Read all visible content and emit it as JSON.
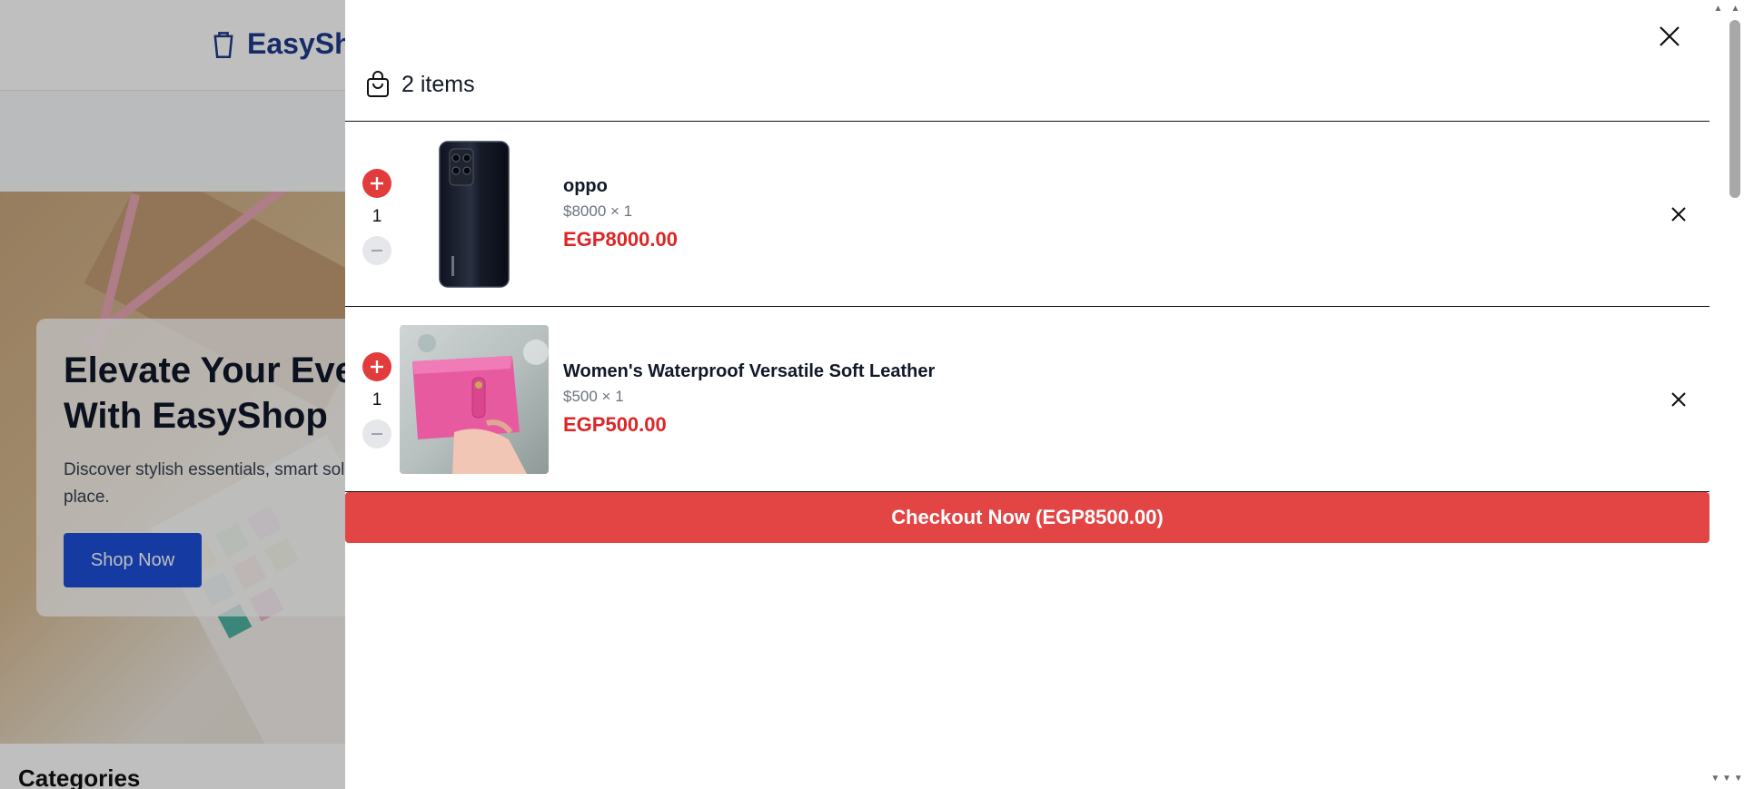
{
  "background": {
    "logo_text": "EasyShop",
    "hero_title_line1": "Elevate Your Everyday",
    "hero_title_line2": "With EasyShop",
    "hero_sub_line1": "Discover stylish essentials, smart solutions",
    "hero_sub_line2": "place.",
    "shop_button": "Shop Now",
    "categories_heading": "Categories"
  },
  "cart": {
    "item_count_label": "2 items",
    "items": [
      {
        "name": "oppo",
        "price_line": "$8000 × 1",
        "quantity": "1",
        "total": "EGP8000.00",
        "image_icon": "black-smartphone-photo"
      },
      {
        "name": "Women's Waterproof Versatile Soft Leather",
        "price_line": "$500 × 1",
        "quantity": "1",
        "total": "EGP500.00",
        "image_icon": "pink-leather-wallet-photo"
      }
    ],
    "checkout_label": "Checkout Now (EGP8500.00)"
  },
  "colors": {
    "accent_red": "#e34444",
    "price_red": "#dc2626",
    "brand_blue": "#1e3a8a",
    "button_blue": "#1d4ed8"
  }
}
